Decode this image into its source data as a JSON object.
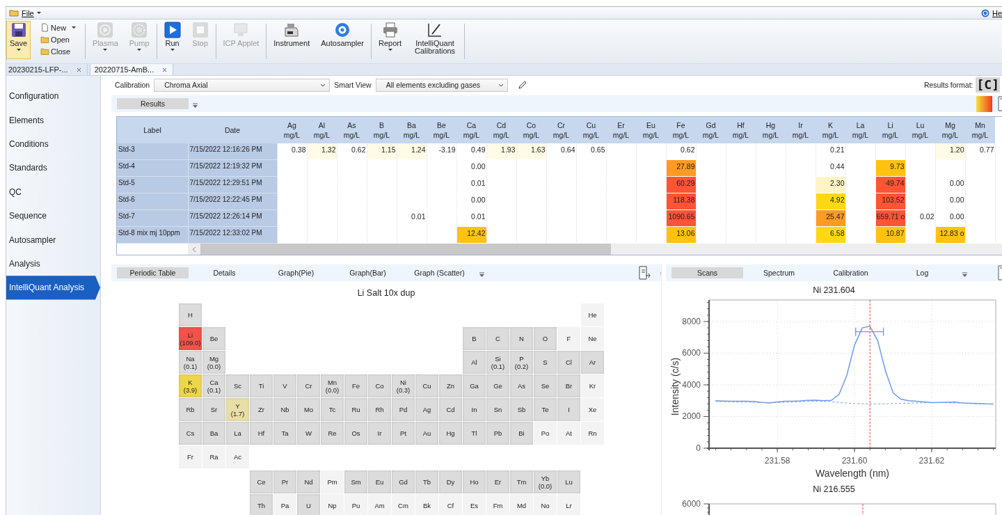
{
  "menu": {
    "items": [
      {
        "label": "File",
        "dropdown": true
      }
    ],
    "help": "He"
  },
  "toolbar": {
    "groups": [
      [
        {
          "kind": "large",
          "label": "Save",
          "dropdown": true,
          "disabled": false,
          "highlighted": true
        },
        {
          "kind": "small",
          "label": "New",
          "dropdown": true,
          "disabled": false,
          "highlighted": false
        },
        {
          "kind": "small",
          "label": "Open",
          "dropdown": false,
          "disabled": false,
          "highlighted": false
        },
        {
          "kind": "small",
          "label": "Close",
          "dropdown": false,
          "disabled": false,
          "highlighted": false
        }
      ],
      [
        {
          "kind": "large",
          "label": "Plasma",
          "dropdown": true,
          "disabled": true,
          "highlighted": false
        },
        {
          "kind": "large",
          "label": "Pump",
          "dropdown": true,
          "disabled": true,
          "highlighted": false
        }
      ],
      [
        {
          "kind": "large",
          "label": "Run",
          "dropdown": true,
          "disabled": false,
          "highlighted": false
        },
        {
          "kind": "large",
          "label": "Stop",
          "dropdown": false,
          "disabled": true,
          "highlighted": false
        }
      ],
      [
        {
          "kind": "large",
          "label": "ICP Applet",
          "dropdown": false,
          "disabled": true,
          "highlighted": false
        }
      ],
      [
        {
          "kind": "large",
          "label": "Instrument",
          "dropdown": false,
          "disabled": false,
          "highlighted": false
        },
        {
          "kind": "large",
          "label": "Autosampler",
          "dropdown": false,
          "disabled": false,
          "highlighted": false
        }
      ],
      [
        {
          "kind": "large",
          "label": "Report",
          "dropdown": true,
          "disabled": false,
          "highlighted": false
        },
        {
          "kind": "large",
          "label": "IntelliQuant Calibrations",
          "dropdown": false,
          "disabled": false,
          "highlighted": false
        }
      ]
    ]
  },
  "doc_tabs": [
    {
      "label": "20230215-LFP-...",
      "selected": false
    },
    {
      "label": "20220715-AmB...",
      "selected": true
    }
  ],
  "sidebar": {
    "items": [
      {
        "label": "Configuration",
        "selected": false
      },
      {
        "label": "Elements",
        "selected": false
      },
      {
        "label": "Conditions",
        "selected": false
      },
      {
        "label": "Standards",
        "selected": false
      },
      {
        "label": "QC",
        "selected": false
      },
      {
        "label": "Sequence",
        "selected": false
      },
      {
        "label": "Autosampler",
        "selected": false
      },
      {
        "label": "Analysis",
        "selected": false
      },
      {
        "label": "IntelliQuant Analysis",
        "selected": true
      }
    ]
  },
  "filters": {
    "calibration": {
      "label": "Calibration",
      "value": "Chroma Axial"
    },
    "smart_view": {
      "label": "Smart View",
      "value": "All elements excluding gases"
    },
    "results_format": {
      "label": "Results format:",
      "value": "[C]"
    }
  },
  "results_tabs": [
    {
      "label": "Results",
      "selected": true
    }
  ],
  "table": {
    "columns": [
      {
        "label": "Label"
      },
      {
        "label": "Date"
      }
    ],
    "element_columns": [
      {
        "element": "Ag",
        "unit": "mg/L"
      },
      {
        "element": "Al",
        "unit": "mg/L"
      },
      {
        "element": "As",
        "unit": "mg/L"
      },
      {
        "element": "B",
        "unit": "mg/L"
      },
      {
        "element": "Ba",
        "unit": "mg/L"
      },
      {
        "element": "Be",
        "unit": "mg/L"
      },
      {
        "element": "Ca",
        "unit": "mg/L"
      },
      {
        "element": "Cd",
        "unit": "mg/L"
      },
      {
        "element": "Co",
        "unit": "mg/L"
      },
      {
        "element": "Cr",
        "unit": "mg/L"
      },
      {
        "element": "Cu",
        "unit": "mg/L"
      },
      {
        "element": "Er",
        "unit": "mg/L"
      },
      {
        "element": "Eu",
        "unit": "mg/L"
      },
      {
        "element": "Fe",
        "unit": "mg/L"
      },
      {
        "element": "Gd",
        "unit": "mg/L"
      },
      {
        "element": "Hf",
        "unit": "mg/L"
      },
      {
        "element": "Hg",
        "unit": "mg/L"
      },
      {
        "element": "Ir",
        "unit": "mg/L"
      },
      {
        "element": "K",
        "unit": "mg/L"
      },
      {
        "element": "La",
        "unit": "mg/L"
      },
      {
        "element": "Li",
        "unit": "mg/L"
      },
      {
        "element": "Lu",
        "unit": "mg/L"
      },
      {
        "element": "Mg",
        "unit": "mg/L"
      },
      {
        "element": "Mn",
        "unit": "mg/L"
      }
    ],
    "rows": [
      {
        "label": "Std-3",
        "date": "7/15/2022 12:16:26 PM",
        "cells": [
          {
            "value": "0.38"
          },
          {
            "value": "1.32",
            "color": "#fffbe6"
          },
          {
            "value": "0.62"
          },
          {
            "value": "1.15",
            "color": "#fffbe6"
          },
          {
            "value": "1.24",
            "color": "#fffbe6"
          },
          {
            "value": "-3.19"
          },
          {
            "value": "0.49"
          },
          {
            "value": "1.93",
            "color": "#fffbe6"
          },
          {
            "value": "1.63",
            "color": "#fffbe6"
          },
          {
            "value": "0.64"
          },
          {
            "value": "0.65"
          },
          null,
          null,
          {
            "value": "0.62"
          },
          null,
          null,
          null,
          null,
          {
            "value": "0.21"
          },
          null,
          null,
          null,
          {
            "value": "1.20",
            "color": "#fffbe6"
          },
          {
            "value": "0.77"
          }
        ]
      },
      {
        "label": "Std-4",
        "date": "7/15/2022 12:19:32 PM",
        "cells": [
          null,
          null,
          null,
          null,
          null,
          null,
          {
            "value": "0.00"
          },
          null,
          null,
          null,
          null,
          null,
          null,
          {
            "value": "27.89",
            "color": "#ff9a22"
          },
          null,
          null,
          null,
          null,
          {
            "value": "0.44"
          },
          null,
          {
            "value": "9.73",
            "color": "#ffc20e"
          },
          null,
          null,
          null
        ]
      },
      {
        "label": "Std-5",
        "date": "7/15/2022 12:29:51 PM",
        "cells": [
          null,
          null,
          null,
          null,
          null,
          null,
          {
            "value": "0.01"
          },
          null,
          null,
          null,
          null,
          null,
          null,
          {
            "value": "60.29",
            "color": "#ff5436"
          },
          null,
          null,
          null,
          null,
          {
            "value": "2.30",
            "color": "#fff4c6"
          },
          null,
          {
            "value": "49.74",
            "color": "#ff5436"
          },
          null,
          {
            "value": "0.00"
          },
          null
        ]
      },
      {
        "label": "Std-6",
        "date": "7/15/2022 12:22:45 PM",
        "cells": [
          null,
          null,
          null,
          null,
          null,
          null,
          {
            "value": "0.00"
          },
          null,
          null,
          null,
          null,
          null,
          null,
          {
            "value": "118.38",
            "color": "#ff5436"
          },
          null,
          null,
          null,
          null,
          {
            "value": "4.92",
            "color": "#ffd814"
          },
          null,
          {
            "value": "103.52",
            "color": "#ff5436"
          },
          null,
          {
            "value": "0.00"
          },
          null
        ]
      },
      {
        "label": "Std-7",
        "date": "7/15/2022 12:26:14 PM",
        "cells": [
          null,
          null,
          null,
          null,
          {
            "value": "0.01"
          },
          null,
          {
            "value": "0.01"
          },
          null,
          null,
          null,
          null,
          null,
          null,
          {
            "value": "1090.65",
            "color": "#ff5436"
          },
          null,
          null,
          null,
          null,
          {
            "value": "25.47",
            "color": "#ff9a22"
          },
          null,
          {
            "value": "659.71 o",
            "color": "#ff5436"
          },
          {
            "value": "0.02"
          },
          {
            "value": "0.00"
          },
          null
        ]
      },
      {
        "label": "Std-8 mix mj 10ppm",
        "date": "7/15/2022 12:33:02 PM",
        "cells": [
          null,
          null,
          null,
          null,
          null,
          null,
          {
            "value": "12.42",
            "color": "#ffc20e"
          },
          null,
          null,
          null,
          null,
          null,
          null,
          {
            "value": "13.06",
            "color": "#ffc20e"
          },
          null,
          null,
          null,
          null,
          {
            "value": "6.58",
            "color": "#ffd814"
          },
          null,
          {
            "value": "10.87",
            "color": "#ffc20e"
          },
          null,
          {
            "value": "12.83 o",
            "color": "#ffc20e"
          },
          null
        ]
      }
    ]
  },
  "lower_left": {
    "tabs": [
      {
        "label": "Periodic Table",
        "selected": true
      },
      {
        "label": "Details",
        "selected": false
      },
      {
        "label": "Graph(Pie)",
        "selected": false
      },
      {
        "label": "Graph(Bar)",
        "selected": false
      },
      {
        "label": "Graph (Scatter)",
        "selected": false
      }
    ],
    "title": "Li Salt 10x dup",
    "periodic_table": {
      "periods": [
        {
          "left": [
            {
              "symbol": "H",
              "active": true
            }
          ],
          "right": [
            {
              "symbol": "He",
              "active": false
            }
          ]
        },
        {
          "left": [
            {
              "symbol": "Li",
              "value": "(109.0)",
              "active": true,
              "color": "#f2524b"
            },
            {
              "symbol": "Be",
              "active": true
            }
          ],
          "right": [
            {
              "symbol": "B",
              "active": true
            },
            {
              "symbol": "C",
              "active": true
            },
            {
              "symbol": "N",
              "active": true
            },
            {
              "symbol": "O",
              "active": true
            },
            {
              "symbol": "F",
              "active": false
            },
            {
              "symbol": "Ne",
              "active": false
            }
          ]
        },
        {
          "left": [
            {
              "symbol": "Na",
              "value": "(0.1)",
              "active": true
            },
            {
              "symbol": "Mg",
              "value": "(0.0)",
              "active": true
            }
          ],
          "right": [
            {
              "symbol": "Al",
              "active": true
            },
            {
              "symbol": "Si",
              "value": "(0.1)",
              "active": true
            },
            {
              "symbol": "P",
              "value": "(0.2)",
              "active": true
            },
            {
              "symbol": "S",
              "active": true
            },
            {
              "symbol": "Cl",
              "active": true
            },
            {
              "symbol": "Ar",
              "active": true
            }
          ]
        },
        {
          "left": [
            {
              "symbol": "K",
              "value": "(3.9)",
              "active": true,
              "color": "#ecd64a"
            },
            {
              "symbol": "Ca",
              "value": "(0.1)",
              "active": true
            },
            {
              "symbol": "Sc",
              "active": true
            },
            {
              "symbol": "Ti",
              "active": true
            },
            {
              "symbol": "V",
              "active": true
            },
            {
              "symbol": "Cr",
              "active": true
            },
            {
              "symbol": "Mn",
              "value": "(0.0)",
              "active": true
            },
            {
              "symbol": "Fe",
              "active": true
            },
            {
              "symbol": "Co",
              "active": true
            },
            {
              "symbol": "Ni",
              "value": "(0.3)",
              "active": true
            },
            {
              "symbol": "Cu",
              "active": true
            },
            {
              "symbol": "Zn",
              "active": true
            },
            {
              "symbol": "Ga",
              "active": true
            },
            {
              "symbol": "Ge",
              "active": true
            },
            {
              "symbol": "As",
              "active": true
            },
            {
              "symbol": "Se",
              "active": true
            },
            {
              "symbol": "Br",
              "active": true
            },
            {
              "symbol": "Kr",
              "active": false
            }
          ]
        },
        {
          "left": [
            {
              "symbol": "Rb",
              "active": true
            },
            {
              "symbol": "Sr",
              "active": true
            },
            {
              "symbol": "Y",
              "value": "(1.7)",
              "active": true,
              "color": "#e8dfa6"
            },
            {
              "symbol": "Zr",
              "active": true
            },
            {
              "symbol": "Nb",
              "active": true
            },
            {
              "symbol": "Mo",
              "active": true
            },
            {
              "symbol": "Tc",
              "active": true
            },
            {
              "symbol": "Ru",
              "active": true
            },
            {
              "symbol": "Rh",
              "active": true
            },
            {
              "symbol": "Pd",
              "active": true
            },
            {
              "symbol": "Ag",
              "active": true
            },
            {
              "symbol": "Cd",
              "active": true
            },
            {
              "symbol": "In",
              "active": true
            },
            {
              "symbol": "Sn",
              "active": true
            },
            {
              "symbol": "Sb",
              "active": true
            },
            {
              "symbol": "Te",
              "active": true
            },
            {
              "symbol": "I",
              "active": true
            },
            {
              "symbol": "Xe",
              "active": false
            }
          ]
        },
        {
          "left": [
            {
              "symbol": "Cs",
              "active": true
            },
            {
              "symbol": "Ba",
              "active": true
            },
            {
              "symbol": "La",
              "active": true
            },
            {
              "symbol": "Hf",
              "active": true
            },
            {
              "symbol": "Ta",
              "active": true
            },
            {
              "symbol": "W",
              "active": true
            },
            {
              "symbol": "Re",
              "active": true
            },
            {
              "symbol": "Os",
              "active": true
            },
            {
              "symbol": "Ir",
              "active": true
            },
            {
              "symbol": "Pt",
              "active": true
            },
            {
              "symbol": "Au",
              "active": true
            },
            {
              "symbol": "Hg",
              "active": true
            },
            {
              "symbol": "Tl",
              "active": true
            },
            {
              "symbol": "Pb",
              "active": true
            },
            {
              "symbol": "Bi",
              "active": true
            },
            {
              "symbol": "Po",
              "active": false
            },
            {
              "symbol": "At",
              "active": false
            },
            {
              "symbol": "Rn",
              "active": false
            }
          ]
        },
        {
          "left": [
            {
              "symbol": "Fr",
              "active": false
            },
            {
              "symbol": "Ra",
              "active": false
            },
            {
              "symbol": "Ac",
              "active": false
            }
          ]
        }
      ],
      "f_block": [
        [
          {
            "symbol": "Ce",
            "active": true
          },
          {
            "symbol": "Pr",
            "active": true
          },
          {
            "symbol": "Nd",
            "active": true
          },
          {
            "symbol": "Pm",
            "active": false
          },
          {
            "symbol": "Sm",
            "active": true
          },
          {
            "symbol": "Eu",
            "active": true
          },
          {
            "symbol": "Gd",
            "active": true
          },
          {
            "symbol": "Tb",
            "active": true
          },
          {
            "symbol": "Dy",
            "active": true
          },
          {
            "symbol": "Ho",
            "active": true
          },
          {
            "symbol": "Er",
            "active": true
          },
          {
            "symbol": "Tm",
            "active": true
          },
          {
            "symbol": "Yb",
            "value": "(0.0)",
            "active": true
          },
          {
            "symbol": "Lu",
            "active": true
          }
        ],
        [
          {
            "symbol": "Th",
            "active": true
          },
          {
            "symbol": "Pa",
            "active": false
          },
          {
            "symbol": "U",
            "active": true
          },
          {
            "symbol": "Np",
            "active": false
          },
          {
            "symbol": "Pu",
            "active": false
          },
          {
            "symbol": "Am",
            "active": false
          },
          {
            "symbol": "Cm",
            "active": false
          },
          {
            "symbol": "Bk",
            "active": false
          },
          {
            "symbol": "Cf",
            "active": false
          },
          {
            "symbol": "Es",
            "active": false
          },
          {
            "symbol": "Fm",
            "active": false
          },
          {
            "symbol": "Md",
            "active": false
          },
          {
            "symbol": "No",
            "active": false
          },
          {
            "symbol": "Lr",
            "active": false
          }
        ]
      ]
    }
  },
  "lower_right": {
    "tabs": [
      {
        "label": "Scans",
        "selected": true
      },
      {
        "label": "Spectrum",
        "selected": false
      },
      {
        "label": "Calibration",
        "selected": false
      },
      {
        "label": "Log",
        "selected": false
      }
    ],
    "chart_data": {
      "type": "line",
      "title": "Ni 231.604",
      "xlabel": "Wavelength (nm)",
      "ylabel": "Intensity (c/s)",
      "x": [
        231.564,
        231.566,
        231.568,
        231.57,
        231.572,
        231.574,
        231.576,
        231.578,
        231.58,
        231.582,
        231.584,
        231.586,
        231.588,
        231.59,
        231.592,
        231.594,
        231.596,
        231.598,
        231.6,
        231.602,
        231.604,
        231.606,
        231.608,
        231.61,
        231.612,
        231.614,
        231.616,
        231.618,
        231.62,
        231.622,
        231.624,
        231.626,
        231.628,
        231.63,
        231.632,
        231.634,
        231.636
      ],
      "series": [
        {
          "color": "#6f9be8",
          "line_style": "solid",
          "values": [
            3000,
            2980,
            2960,
            2960,
            2960,
            2950,
            2890,
            2860,
            2920,
            2960,
            2970,
            2990,
            3020,
            3030,
            3000,
            3020,
            3400,
            4600,
            6500,
            7600,
            7700,
            6800,
            4900,
            3500,
            3100,
            3000,
            2960,
            2920,
            2880,
            2890,
            2900,
            2910,
            2860,
            2840,
            2820,
            2800,
            2790
          ]
        },
        {
          "color": "#6f9be8",
          "line_style": "dashed",
          "values": [
            2950,
            2940,
            2930,
            2920,
            2910,
            2900,
            2880,
            2870,
            2880,
            2900,
            2920,
            2940,
            2960,
            2970,
            2960,
            2930,
            2890,
            2850,
            2820,
            2810,
            2800,
            2800,
            2810,
            2820,
            2830,
            2840,
            2860,
            2870,
            2880,
            2880,
            2870,
            2860,
            2850,
            2830,
            2810,
            2800,
            2790
          ]
        }
      ],
      "xlim": [
        231.5623,
        231.6366
      ],
      "ylim": [
        0,
        9360
      ],
      "xticks": [
        {
          "value": 231.58,
          "label": "231.58"
        },
        {
          "value": 231.6,
          "label": "231.60"
        },
        {
          "value": 231.62,
          "label": "231.62"
        }
      ],
      "yticks": [
        0,
        2000,
        4000,
        6000,
        8000
      ],
      "grid": true,
      "ref_lines": [
        {
          "axis": "x",
          "value": 231.604,
          "color": "#e8413c"
        }
      ]
    },
    "chart_2": {
      "title": "Ni 216.555",
      "ytick": "6000"
    }
  }
}
